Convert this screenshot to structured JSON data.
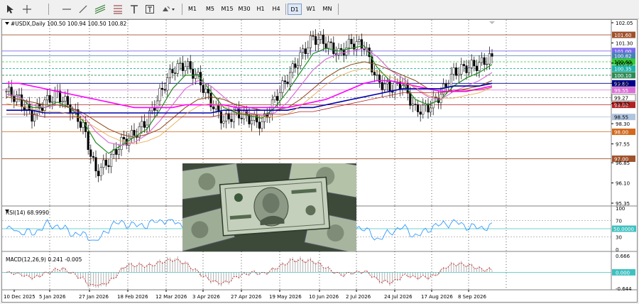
{
  "toolbar": {
    "timeframes": [
      "M1",
      "M5",
      "M15",
      "M30",
      "H1",
      "H4",
      "D1",
      "W1",
      "MN"
    ],
    "active_timeframe": "D1"
  },
  "main_chart": {
    "header": "#USDX,Daily  100.50 100.94 100.50 100.82",
    "price_axis": [
      "102.05",
      "101.30",
      "100.55",
      "99.80",
      "99.05",
      "98.30",
      "97.55",
      "96.85",
      "96.10",
      "95.35"
    ],
    "ylim": [
      95.35,
      102.05
    ],
    "level_labels": [
      {
        "text": "101.60",
        "value": 101.6,
        "color": "#a0522d"
      },
      {
        "text": "101.00",
        "value": 101.0,
        "color": "#7b68ee"
      },
      {
        "text": "100.82",
        "value": 100.82,
        "color": "#4682b4"
      },
      {
        "text": "100.60",
        "value": 100.6,
        "color": "#32cd32"
      },
      {
        "text": "100.35",
        "value": 100.35,
        "color": "#20b2aa"
      },
      {
        "text": "100.10",
        "value": 100.1,
        "color": "#2e8b57"
      },
      {
        "text": "99.80",
        "value": 99.8,
        "color": "#00008b"
      },
      {
        "text": "99.55",
        "value": 99.55,
        "color": "#da70d6"
      },
      {
        "text": "99.27",
        "value": 99.27,
        "color": "#ffffff"
      },
      {
        "text": "99.00",
        "value": 99.0,
        "color": "#b22222"
      },
      {
        "text": "98.55",
        "value": 98.55,
        "color": "#b0c4de"
      },
      {
        "text": "98.00",
        "value": 98.0,
        "color": "#d2691e"
      },
      {
        "text": "97.00",
        "value": 97.0,
        "color": "#a0522d"
      }
    ]
  },
  "rsi": {
    "header": "RSI(14) 68.9990",
    "axis": [
      "100",
      "70",
      "50",
      "30",
      "0"
    ],
    "level_label": "50.0000"
  },
  "macd": {
    "header": "MACD(12,26,9) 0.241 -0.005",
    "axis": [
      "0.666",
      "0.000",
      "-0.644"
    ],
    "level_label": "0.000"
  },
  "time_axis": [
    "10 Dec 2025",
    "5 Jan 2026",
    "27 Jan 2026",
    "18 Feb 2026",
    "12 Mar 2026",
    "3 Apr 2026",
    "27 Apr 2026",
    "19 May 2026",
    "10 Jun 2026",
    "2 Jul 2026",
    "24 Jul 2026",
    "17 Aug 2026",
    "8 Sep 2026"
  ],
  "chart_data": {
    "type": "line",
    "series": [
      {
        "values": [
          99.5,
          99.2,
          98.6,
          99.1,
          99.4,
          98.9,
          98.2,
          96.5,
          96.9,
          97.6,
          97.9,
          98.4,
          99.4,
          100.3,
          100.5,
          100.0,
          99.1,
          98.4,
          98.7,
          98.5,
          98.3,
          99.2,
          100.0,
          100.8,
          101.5,
          101.3,
          100.9,
          101.3,
          101.2,
          99.9,
          99.6,
          99.8,
          98.8,
          98.9,
          99.4,
          100.2,
          100.4,
          100.5,
          100.8
        ]
      },
      {
        "values": [
          99.4,
          99.3,
          98.9,
          98.9,
          99.1,
          98.9,
          98.4,
          97.6,
          97.2,
          97.5,
          97.8,
          98.1,
          98.8,
          99.6,
          100.1,
          100.1,
          99.5,
          98.9,
          98.7,
          98.6,
          98.5,
          98.9,
          99.5,
          100.2,
          100.9,
          101.1,
          101.0,
          101.1,
          101.2,
          100.4,
          99.9,
          99.8,
          99.2,
          99.0,
          99.2,
          99.7,
          100.0,
          100.2,
          100.5
        ]
      },
      {
        "values": [
          99.4,
          99.3,
          99.0,
          98.9,
          99.0,
          98.9,
          98.6,
          98.0,
          97.6,
          97.5,
          97.6,
          97.9,
          98.4,
          99.0,
          99.6,
          99.9,
          99.7,
          99.3,
          98.9,
          98.7,
          98.6,
          98.7,
          99.1,
          99.7,
          100.3,
          100.7,
          100.9,
          101.0,
          101.1,
          100.8,
          100.3,
          100.0,
          99.6,
          99.3,
          99.2,
          99.5,
          99.7,
          99.9,
          100.2
        ]
      },
      {
        "values": [
          99.3,
          99.2,
          99.1,
          99.0,
          99.0,
          98.9,
          98.7,
          98.4,
          98.1,
          97.9,
          97.8,
          97.9,
          98.1,
          98.5,
          98.9,
          99.2,
          99.3,
          99.2,
          99.0,
          98.9,
          98.8,
          98.8,
          98.9,
          99.2,
          99.6,
          100.0,
          100.3,
          100.5,
          100.6,
          100.5,
          100.3,
          100.1,
          99.9,
          99.6,
          99.5,
          99.5,
          99.6,
          99.7,
          99.9
        ]
      },
      {
        "values": [
          99.8,
          99.8,
          99.7,
          99.6,
          99.5,
          99.4,
          99.3,
          99.2,
          99.1,
          99.0,
          98.9,
          98.9,
          98.9,
          98.9,
          99.0,
          99.0,
          99.0,
          99.0,
          98.9,
          98.9,
          98.9,
          98.9,
          98.9,
          99.0,
          99.1,
          99.2,
          99.4,
          99.6,
          99.8,
          99.9,
          99.9,
          99.8,
          99.7,
          99.6,
          99.5,
          99.5,
          99.5,
          99.6,
          99.7
        ]
      },
      {
        "values": [
          98.8,
          98.8,
          98.8,
          98.7,
          98.7,
          98.7,
          98.7,
          98.7,
          98.7,
          98.7,
          98.7,
          98.7,
          98.7,
          98.7,
          98.7,
          98.7,
          98.7,
          98.8,
          98.8,
          98.8,
          98.8,
          98.8,
          98.8,
          98.9,
          98.9,
          99.0,
          99.1,
          99.2,
          99.3,
          99.4,
          99.5,
          99.6,
          99.6,
          99.6,
          99.6,
          99.7,
          99.7,
          99.7,
          99.8
        ]
      }
    ]
  }
}
